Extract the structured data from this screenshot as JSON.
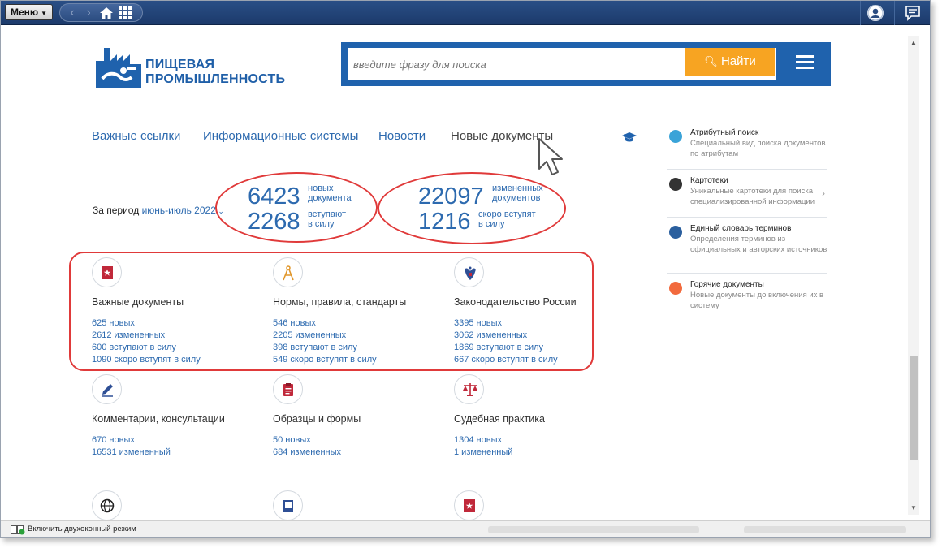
{
  "toolbar": {
    "menu_label": "Меню"
  },
  "header": {
    "brand_line1": "ПИЩЕВАЯ",
    "brand_line2": "ПРОМЫШЛЕННОСТЬ",
    "search_placeholder": "введите фразу для поиска",
    "search_button": "Найти"
  },
  "tabs": [
    {
      "label": "Важные ссылки"
    },
    {
      "label": "Информационные системы"
    },
    {
      "label": "Новости"
    },
    {
      "label": "Новые документы"
    }
  ],
  "stats": {
    "period_label": "За период",
    "period_value": "июнь-июль 2022",
    "new_count": "6423",
    "new_caption_1": "новых",
    "new_caption_2": "документа",
    "effective_count": "2268",
    "effective_caption_1": "вступают",
    "effective_caption_2": "в силу",
    "changed_count": "22097",
    "changed_caption_1": "измененных",
    "changed_caption_2": "документов",
    "soon_count": "1216",
    "soon_caption_1": "скоро вступят",
    "soon_caption_2": "в силу"
  },
  "categories": [
    {
      "title": "Важные документы",
      "icon": "bookmark-star-icon",
      "lines": [
        "625 новых",
        "2612 измененных",
        "600 вступают в силу",
        "1090 скоро вступят в силу"
      ]
    },
    {
      "title": "Нормы, правила, стандарты",
      "icon": "compass-icon",
      "lines": [
        "546 новых",
        "2205 измененных",
        "398 вступают в силу",
        "549 скоро вступят в силу"
      ]
    },
    {
      "title": "Законодательство России",
      "icon": "coat-of-arms-icon",
      "lines": [
        "3395 новых",
        "3062 измененных",
        "1869 вступают в силу",
        "667 скоро вступят в силу"
      ]
    },
    {
      "title": "Комментарии, консультации",
      "icon": "pen-icon",
      "lines": [
        "670 новых",
        "16531 измененный"
      ]
    },
    {
      "title": "Образцы и формы",
      "icon": "clipboard-icon",
      "lines": [
        "50 новых",
        "684 измененных"
      ]
    },
    {
      "title": "Судебная практика",
      "icon": "scales-icon",
      "lines": [
        "1304 новых",
        "1 измененный"
      ]
    }
  ],
  "sidebar": [
    {
      "title": "Атрибутный поиск",
      "desc": "Специальный вид поиска документов по атрибутам",
      "icon": "attribute-search-icon",
      "color": "#3aa3d8"
    },
    {
      "title": "Картотеки",
      "desc": "Уникальные картотеки для поиска специализированной информации",
      "icon": "card-index-icon",
      "color": "#333333"
    },
    {
      "title": "Единый словарь терминов",
      "desc": "Определения терминов из официальных и авторских источников",
      "icon": "dictionary-icon",
      "color": "#2a5f9e"
    },
    {
      "title": "Горячие документы",
      "desc": "Новые документы до включения их в систему",
      "icon": "hot-docs-icon",
      "color": "#f26a3d"
    }
  ],
  "status": {
    "dual_window_label": "Включить двухоконный режим"
  },
  "colors": {
    "accent": "#2d6aaf",
    "search_button": "#f7a422",
    "highlight": "#e03a3a",
    "toolbar": "#1c3a6b"
  }
}
